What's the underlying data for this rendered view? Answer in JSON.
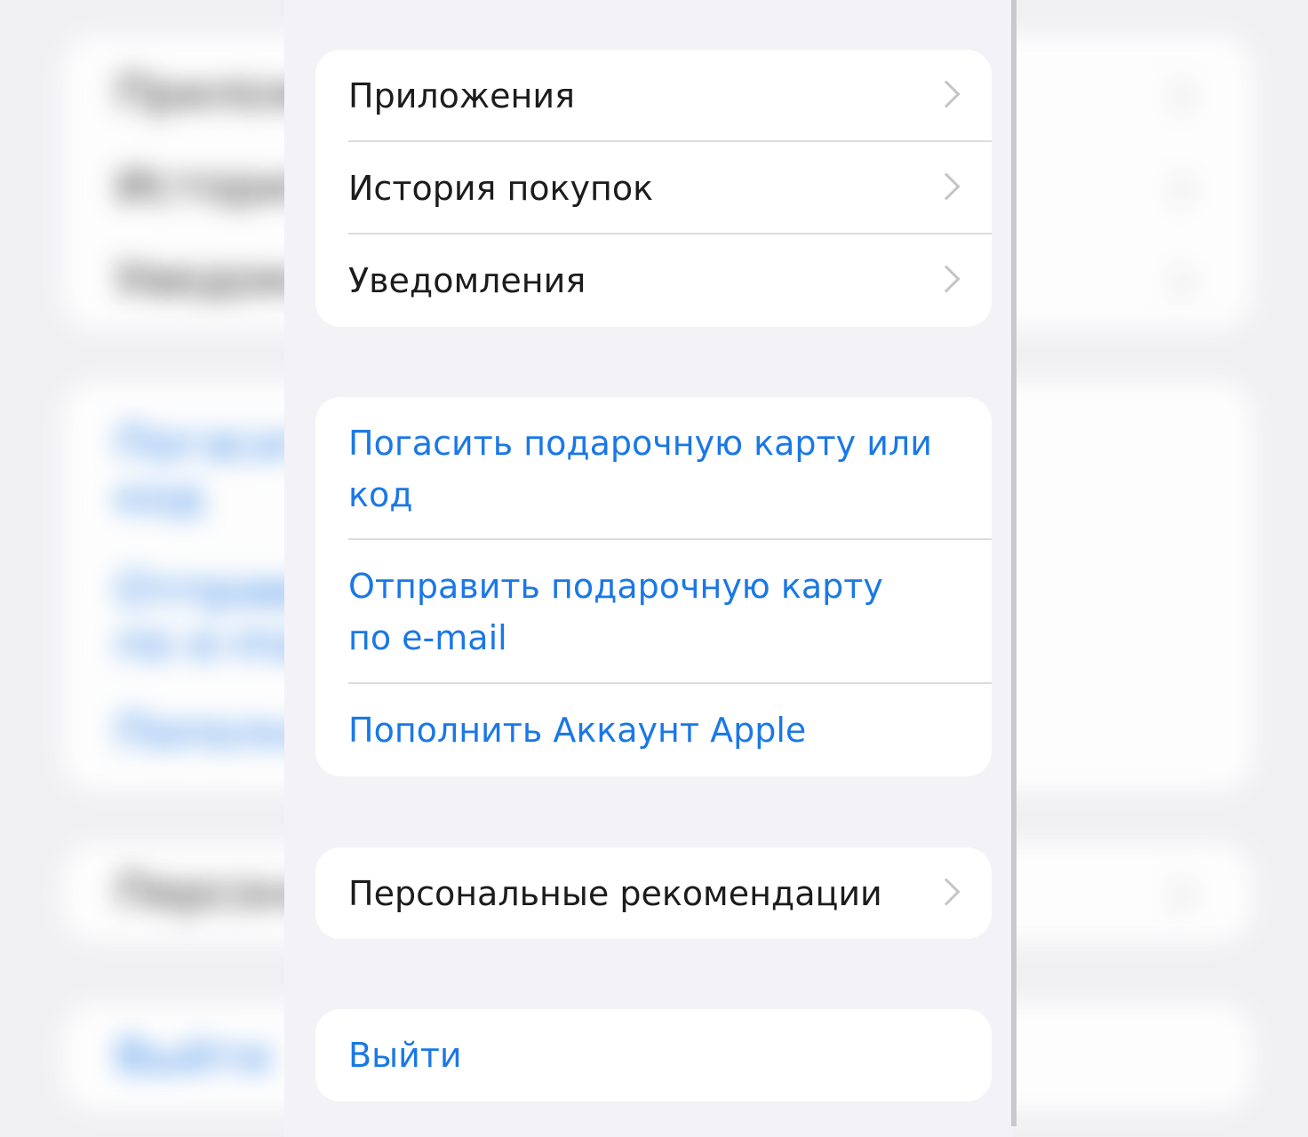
{
  "groups": [
    {
      "items": [
        {
          "label": "Приложения",
          "has_chevron": true
        },
        {
          "label": "История покупок",
          "has_chevron": true
        },
        {
          "label": "Уведомления",
          "has_chevron": true
        }
      ]
    },
    {
      "items": [
        {
          "label_line1": "Погасить подарочную карту или",
          "label_line2": "код"
        },
        {
          "label_line1": "Отправить подарочную карту",
          "label_line2": "по e-mail"
        },
        {
          "label": "Пополнить Аккаунт Apple"
        }
      ]
    },
    {
      "items": [
        {
          "label": "Персональные рекомендации",
          "has_chevron": true
        }
      ]
    },
    {
      "items": [
        {
          "label": "Выйти"
        }
      ]
    }
  ],
  "colors": {
    "background": "#f2f2f7",
    "card": "#ffffff",
    "link": "#1a78e6",
    "text": "#1c1c1e",
    "chevron": "#c4c4c9"
  },
  "icons": {
    "row_chevron": "chevron-right-icon"
  }
}
